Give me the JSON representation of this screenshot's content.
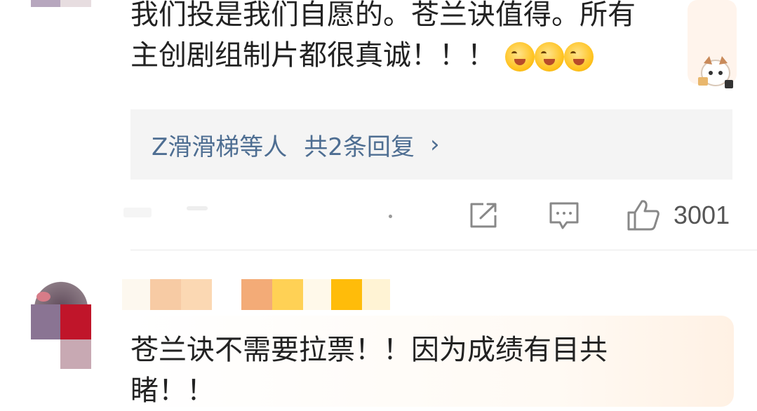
{
  "comment1": {
    "text_line1": "我们投是我们自愿的。苍兰诀值得。所有",
    "text_line2": "主创剧组制片都很真诚！！！",
    "emoji_names": [
      "laugh-cry-icon",
      "laugh-cry-icon",
      "laugh-cry-icon"
    ],
    "replies": {
      "names": "Z滑滑梯等人",
      "count_label": "共2条回复",
      "chevron": "›"
    },
    "actions": {
      "like_count": "3001"
    }
  },
  "comment2": {
    "text_line1": "苍兰诀不需要拉票！！因为成绩有目共",
    "text_line2": "睹！！"
  },
  "colors": {
    "reply_link": "#4e6e92",
    "text": "#222222",
    "reply_bg": "#f4f4f4",
    "icon_gray": "#888888"
  }
}
